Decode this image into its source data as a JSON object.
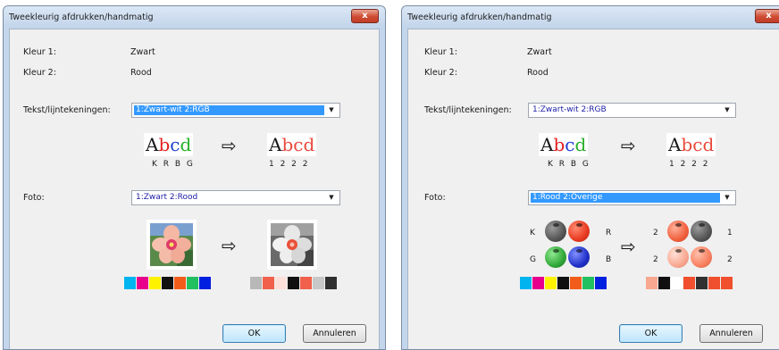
{
  "left": {
    "title": "Tweekleurig afdrukken/handmatig",
    "close": "x",
    "color1_label": "Kleur 1:",
    "color1_value": "Zwart",
    "color2_label": "Kleur 2:",
    "color2_value": "Rood",
    "text_label": "Tekst/lijntekeningen:",
    "text_select": "1:Zwart-wit 2:RGB",
    "abcd": [
      "A",
      "b",
      "c",
      "d"
    ],
    "abcd_before_colors": [
      "#1a1a1a",
      "#e02020",
      "#2040d0",
      "#28b028"
    ],
    "abcd_after_colors": [
      "#1a1a1a",
      "#e84a3c",
      "#e84a3c",
      "#e84a3c"
    ],
    "letters_before": "K R B G",
    "letters_after": "1 2 2 2",
    "arrow": "⇨",
    "photo_label": "Foto:",
    "photo_select": "1:Zwart 2:Rood",
    "swatches_before": [
      "#00b4f0",
      "#e8008c",
      "#fff200",
      "#101010",
      "#f25c1a",
      "#20c060",
      "#0020e0"
    ],
    "swatches_after": [
      "#b8b8b8",
      "#f0604a",
      "#fde0da",
      "#101010",
      "#f0604a",
      "#c8c8c8",
      "#303030"
    ],
    "ok": "OK",
    "cancel": "Annuleren"
  },
  "right": {
    "title": "Tweekleurig afdrukken/handmatig",
    "close": "x",
    "color1_label": "Kleur 1:",
    "color1_value": "Zwart",
    "color2_label": "Kleur 2:",
    "color2_value": "Rood",
    "text_label": "Tekst/lijntekeningen:",
    "text_select": "1:Zwart-wit 2:RGB",
    "abcd": [
      "A",
      "b",
      "c",
      "d"
    ],
    "abcd_before_colors": [
      "#1a1a1a",
      "#e02020",
      "#2040d0",
      "#28b028"
    ],
    "abcd_after_colors": [
      "#1a1a1a",
      "#e84a3c",
      "#e84a3c",
      "#e84a3c"
    ],
    "letters_before": "K R B G",
    "letters_after": "1 2 2 2",
    "arrow": "⇨",
    "photo_label": "Foto:",
    "photo_select": "1:Rood 2:Overige",
    "balls_before_labels": [
      "K",
      "R",
      "G",
      "B"
    ],
    "balls_after_labels": [
      "2",
      "1",
      "2",
      "2"
    ],
    "balls_before_colors": [
      "#555555",
      "#e83a20",
      "#30a838",
      "#2030c8"
    ],
    "balls_after_colors": [
      "#f0603e",
      "#555555",
      "#f8a890",
      "#f88060"
    ],
    "swatches_before": [
      "#00b4f0",
      "#e8008c",
      "#fff200",
      "#101010",
      "#f25c1a",
      "#20c060",
      "#0020e0"
    ],
    "swatches_after": [
      "#f8a890",
      "#101010",
      "#ffffff",
      "#f0502e",
      "#303030",
      "#f0502e",
      "#f0502e"
    ],
    "ok": "OK",
    "cancel": "Annuleren"
  }
}
